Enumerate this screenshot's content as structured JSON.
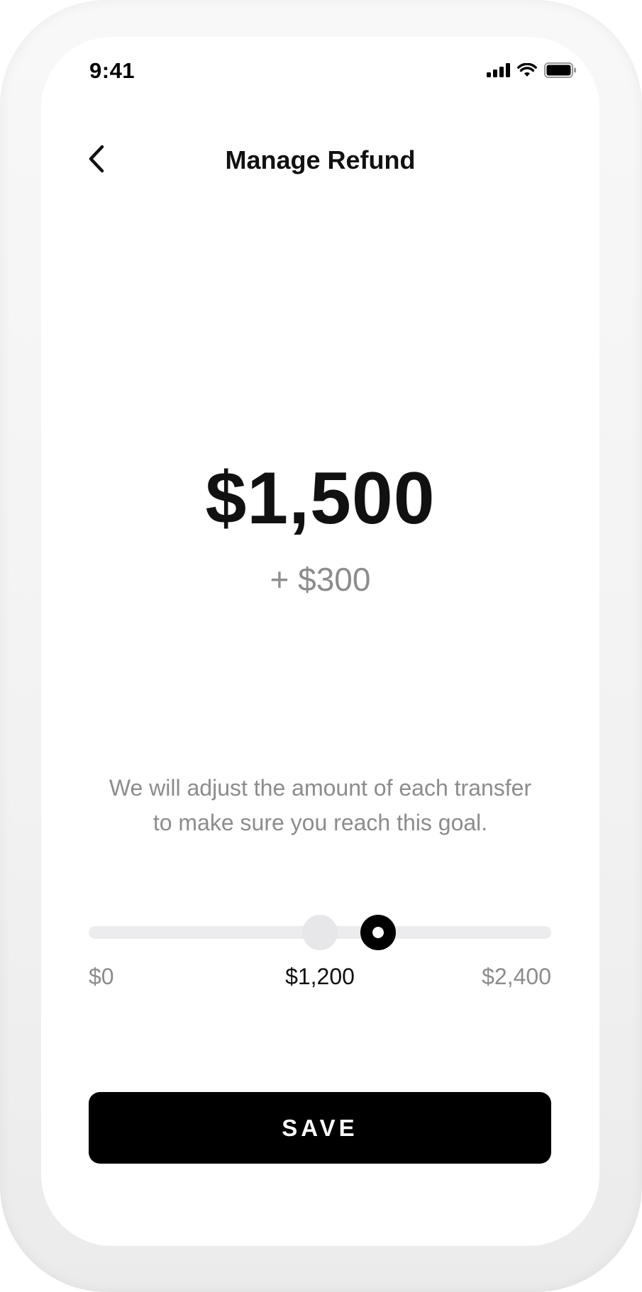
{
  "status_bar": {
    "time": "9:41",
    "icons": [
      "cellular-signal-icon",
      "wifi-icon",
      "battery-icon"
    ]
  },
  "header": {
    "back_icon": "chevron-left-icon",
    "title": "Manage Refund"
  },
  "refund": {
    "amount": "$1,500",
    "delta": "+ $300"
  },
  "description": "We will adjust the amount of each transfer to make sure you reach this goal.",
  "slider": {
    "min_label": "$0",
    "mid_label": "$1,200",
    "max_label": "$2,400",
    "min_value": 0,
    "max_value": 2400,
    "previous_value": 1200,
    "value": 1500
  },
  "actions": {
    "save_label": "SAVE"
  },
  "colors": {
    "primary": "#000000",
    "muted_text": "#8c8c8c",
    "track": "#ececef",
    "background": "#ffffff"
  }
}
